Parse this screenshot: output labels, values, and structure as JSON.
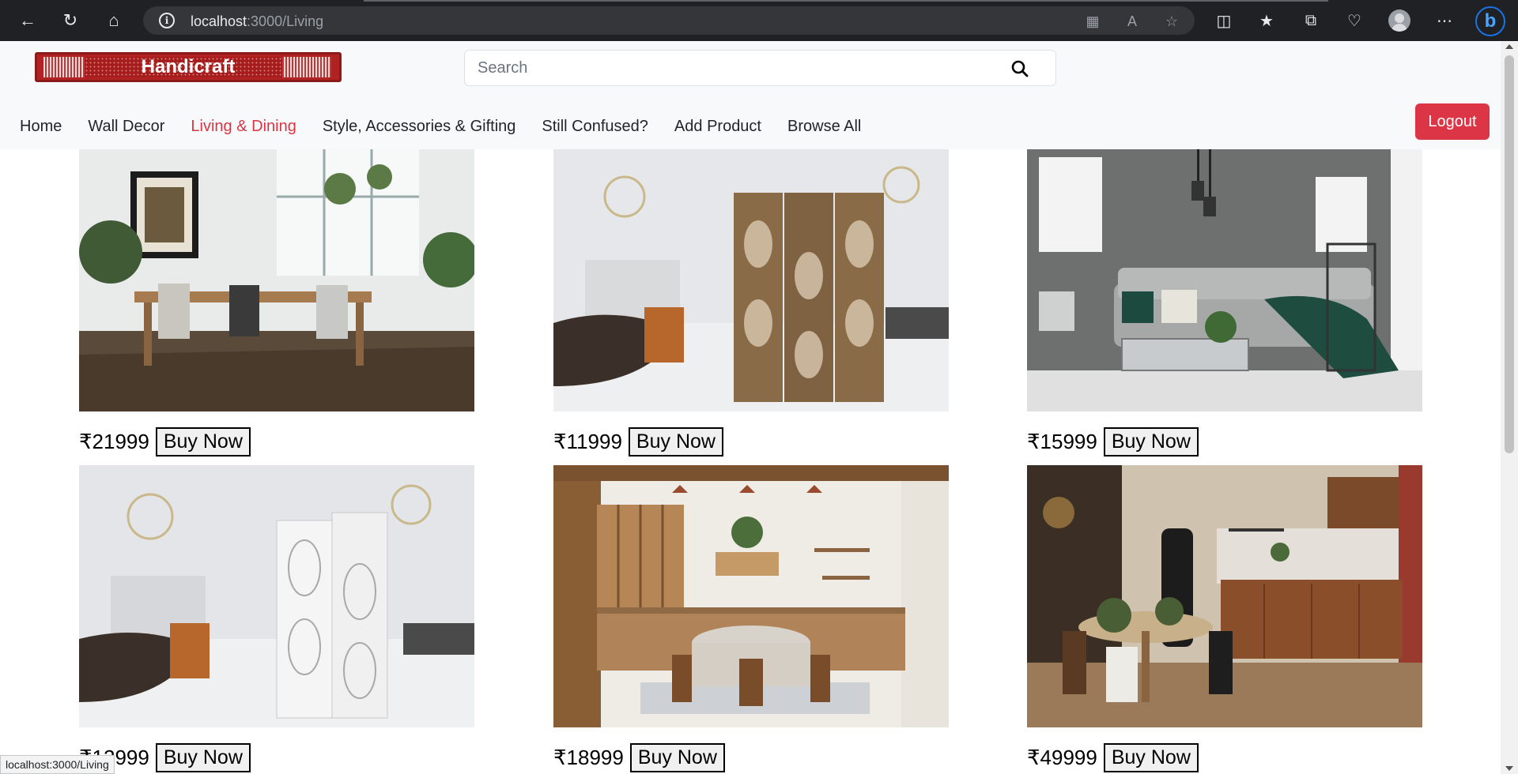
{
  "browser": {
    "url_host": "localhost",
    "url_path": ":3000/Living",
    "status_url": "localhost:3000/Living"
  },
  "header": {
    "logo_text": "Handicraft",
    "search": {
      "placeholder": "Search",
      "value": ""
    },
    "nav": [
      {
        "label": "Home",
        "active": false
      },
      {
        "label": "Wall Decor",
        "active": false
      },
      {
        "label": "Living & Dining",
        "active": true
      },
      {
        "label": "Style, Accessories & Gifting",
        "active": false
      },
      {
        "label": "Still Confused?",
        "active": false
      },
      {
        "label": "Add Product",
        "active": false
      },
      {
        "label": "Browse All",
        "active": false
      }
    ],
    "logout_label": "Logout"
  },
  "products": [
    {
      "price": "₹21999",
      "buy_label": "Buy Now",
      "image": "dining-room-horse-painting"
    },
    {
      "price": "₹11999",
      "buy_label": "Buy Now",
      "image": "wooden-folding-screen"
    },
    {
      "price": "₹15999",
      "buy_label": "Buy Now",
      "image": "grey-living-room-sofa"
    },
    {
      "price": "₹12999",
      "buy_label": "Buy Now",
      "image": "white-folding-screen"
    },
    {
      "price": "₹18999",
      "buy_label": "Buy Now",
      "image": "wooden-kitchen-dining"
    },
    {
      "price": "₹49999",
      "buy_label": "Buy Now",
      "image": "rustic-dining-kitchen"
    }
  ],
  "colors": {
    "accent_red": "#dc3545",
    "logo_red": "#b22222",
    "header_bg": "#f8f9fa"
  }
}
